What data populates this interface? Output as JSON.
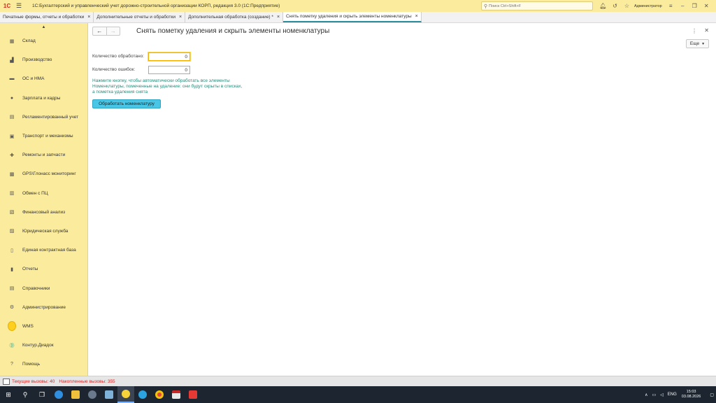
{
  "app": {
    "logo": "1С",
    "title": "1С:Бухгалтерский и управленческий учет дорожно-строительной организации КОРП, редакция 3.0  (1С:Предприятие)",
    "search_placeholder": "Поиск Ctrl+Shift+F",
    "user": "Администратор"
  },
  "tabs": [
    {
      "label": "Печатные формы, отчеты и обработки"
    },
    {
      "label": "Дополнительные отчеты и обработки"
    },
    {
      "label": "Дополнительная обработка (создание) *"
    },
    {
      "label": "Снять пометку удаления и скрыть элементы номенклатуры"
    }
  ],
  "sidebar": {
    "items": [
      {
        "label": "Склад",
        "icon": "warehouse-icon"
      },
      {
        "label": "Производство",
        "icon": "factory-icon"
      },
      {
        "label": "ОС и НМА",
        "icon": "truck-icon"
      },
      {
        "label": "Зарплата и кадры",
        "icon": "person-icon"
      },
      {
        "label": "Регламентированный учет",
        "icon": "ledger-icon"
      },
      {
        "label": "Транспорт и механизмы",
        "icon": "transport-icon"
      },
      {
        "label": "Ремонты и запчасти",
        "icon": "wrench-icon"
      },
      {
        "label": "GPS\\Глонасс мониторинг",
        "icon": "gps-icon"
      },
      {
        "label": "Обмен с ПЦ",
        "icon": "exchange-icon"
      },
      {
        "label": "Финансовый анализ",
        "icon": "finance-icon"
      },
      {
        "label": "Юридическая служба",
        "icon": "legal-icon"
      },
      {
        "label": "Единая контрактная база",
        "icon": "book-icon"
      },
      {
        "label": "Отчеты",
        "icon": "chart-icon"
      },
      {
        "label": "Справочники",
        "icon": "catalog-icon"
      },
      {
        "label": "Администрирование",
        "icon": "gear-icon"
      },
      {
        "label": "WMS",
        "icon": "wms-icon"
      },
      {
        "label": "Контур.Диадок",
        "icon": "diadoc-icon"
      },
      {
        "label": "Помощь",
        "icon": "help-icon"
      }
    ]
  },
  "form": {
    "title": "Снять пометку удаления и скрыть элементы номенклатуры",
    "more_label": "Еще",
    "processed_label": "Количество обработано:",
    "processed_value": "0",
    "errors_label": "Количество ошибок:",
    "errors_value": "0",
    "hint": "Нажмите кнопку, чтобы автоматически обработать все элементы Номенклатуры, помеченные на удаление: они будут скрыты в списках, а пометка удаления снята",
    "process_button": "Обработать номенклатуру"
  },
  "statusbar": {
    "current_calls": "Текущие вызовы: 40",
    "accumulated_calls": "Накопленные вызовы: 355"
  },
  "taskbar": {
    "lang": "ENG",
    "time": "15:03",
    "date": "03.08.2026"
  },
  "colors": {
    "sidebar_bg": "#fbeb9c",
    "accent": "#49c6e5",
    "hint_text": "#2a8a7a",
    "status_red": "#dd2222"
  }
}
